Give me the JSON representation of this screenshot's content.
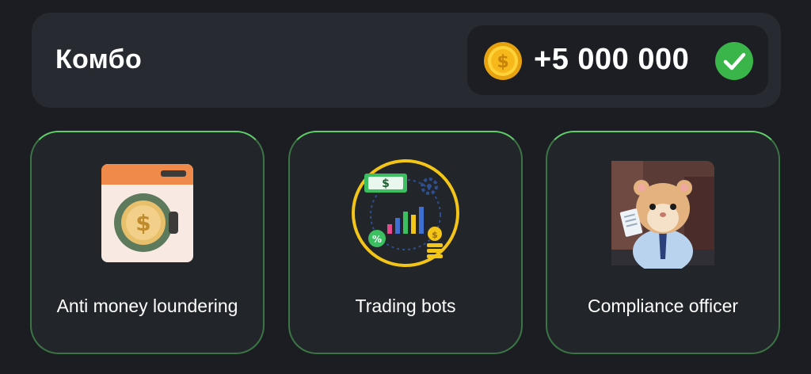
{
  "combo": {
    "title": "Комбо",
    "reward_amount": "+5 000 000",
    "coin_icon": "coin-icon",
    "check_icon": "check-circle-icon",
    "status": "completed"
  },
  "cards": [
    {
      "label": "Anti money loundering",
      "icon": "washing-machine-coin-icon"
    },
    {
      "label": "Trading bots",
      "icon": "trading-chart-icon"
    },
    {
      "label": "Compliance officer",
      "icon": "hamster-officer-image"
    }
  ],
  "colors": {
    "background": "#1b1d22",
    "panel": "#272a30",
    "card_border": "#5fcf68",
    "check_green": "#3ab54a",
    "coin_gold": "#f5b91c"
  }
}
